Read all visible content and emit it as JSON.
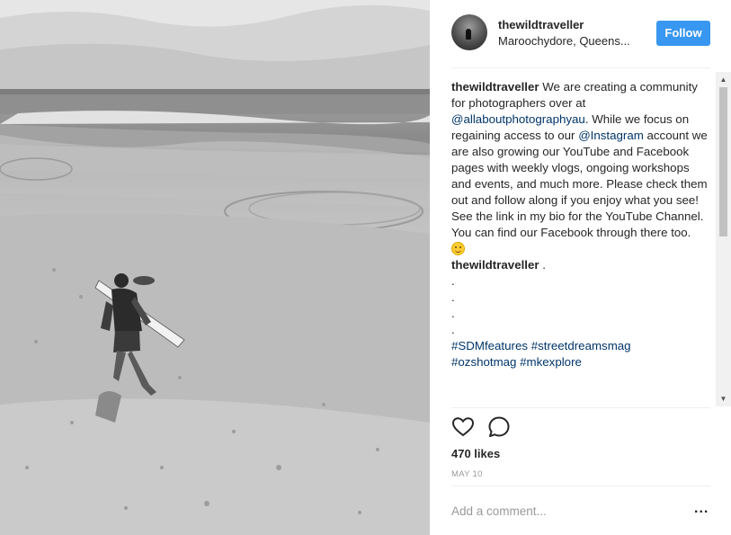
{
  "post": {
    "username": "thewildtraveller",
    "location": "Maroochydore, Queens...",
    "follow_label": "Follow",
    "image_alt": "Black and white photo of a surfer carrying a surfboard across a beach toward the ocean"
  },
  "caption": {
    "username": "thewildtraveller",
    "text_1": " We are creating a community for photographers over at ",
    "mention_1": "@allaboutphotographyau",
    "text_2": ". While we focus on regaining access to our ",
    "mention_2": "@Instagram",
    "text_3": " account we are also growing our YouTube and Facebook pages with weekly vlogs, ongoing workshops and events, and much more. Please check them out and follow along if you enjoy what you see! See the link in my bio for the YouTube Channel. You can find our Facebook through there too.",
    "emoji": "smiling-face"
  },
  "second_comment": {
    "username": "thewildtraveller",
    "text": " .",
    "dots": [
      ".",
      ".",
      ".",
      "."
    ],
    "hashtag_1": "#SDMfeatures",
    "hashtag_2": "#streetdreamsmag",
    "hashtag_3": "#ozshotmag",
    "hashtag_4": "#mkexplore"
  },
  "stats": {
    "likes": "470 likes",
    "date": "MAY 10"
  },
  "comment_box": {
    "placeholder": "Add a comment...",
    "more_label": "..."
  },
  "colors": {
    "follow_button": "#3897f0",
    "mention": "#003569",
    "muted": "#999999"
  }
}
